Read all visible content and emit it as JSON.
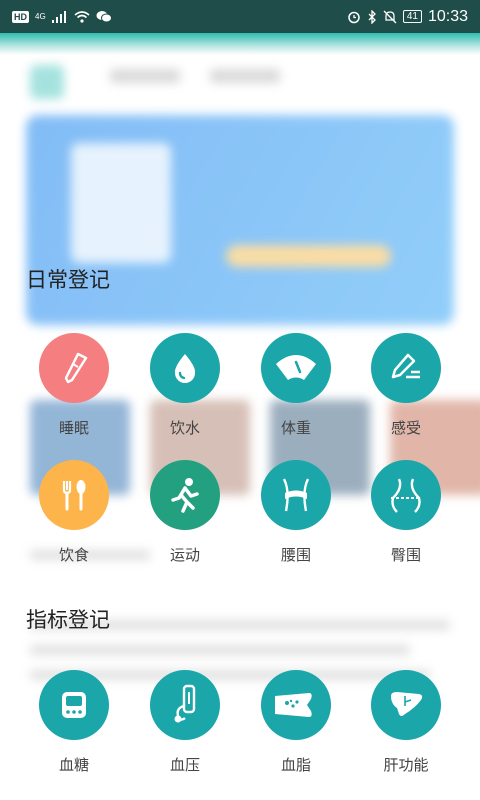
{
  "status_bar": {
    "network": "HD",
    "signal_type": "4G",
    "battery": "41",
    "time": "10:33"
  },
  "sections": {
    "daily": {
      "title": "日常登记",
      "items": [
        {
          "label": "睡眠",
          "icon": "thermometer-icon",
          "color": "#f47e80"
        },
        {
          "label": "饮水",
          "icon": "water-drop-icon",
          "color": "#1ba6a9"
        },
        {
          "label": "体重",
          "icon": "scale-icon",
          "color": "#1ba6a9"
        },
        {
          "label": "感受",
          "icon": "pencil-icon",
          "color": "#1ba6a9"
        },
        {
          "label": "饮食",
          "icon": "fork-spoon-icon",
          "color": "#fdb44a"
        },
        {
          "label": "运动",
          "icon": "running-icon",
          "color": "#23a07f"
        },
        {
          "label": "腰围",
          "icon": "waist-icon",
          "color": "#1ba6a9"
        },
        {
          "label": "臀围",
          "icon": "hip-icon",
          "color": "#1ba6a9"
        }
      ]
    },
    "indicators": {
      "title": "指标登记",
      "items": [
        {
          "label": "血糖",
          "icon": "glucose-meter-icon",
          "color": "#1ba6a9"
        },
        {
          "label": "血压",
          "icon": "blood-pressure-icon",
          "color": "#1ba6a9"
        },
        {
          "label": "血脂",
          "icon": "blood-vessel-icon",
          "color": "#1ba6a9"
        },
        {
          "label": "肝功能",
          "icon": "liver-icon",
          "color": "#1ba6a9"
        }
      ]
    }
  }
}
